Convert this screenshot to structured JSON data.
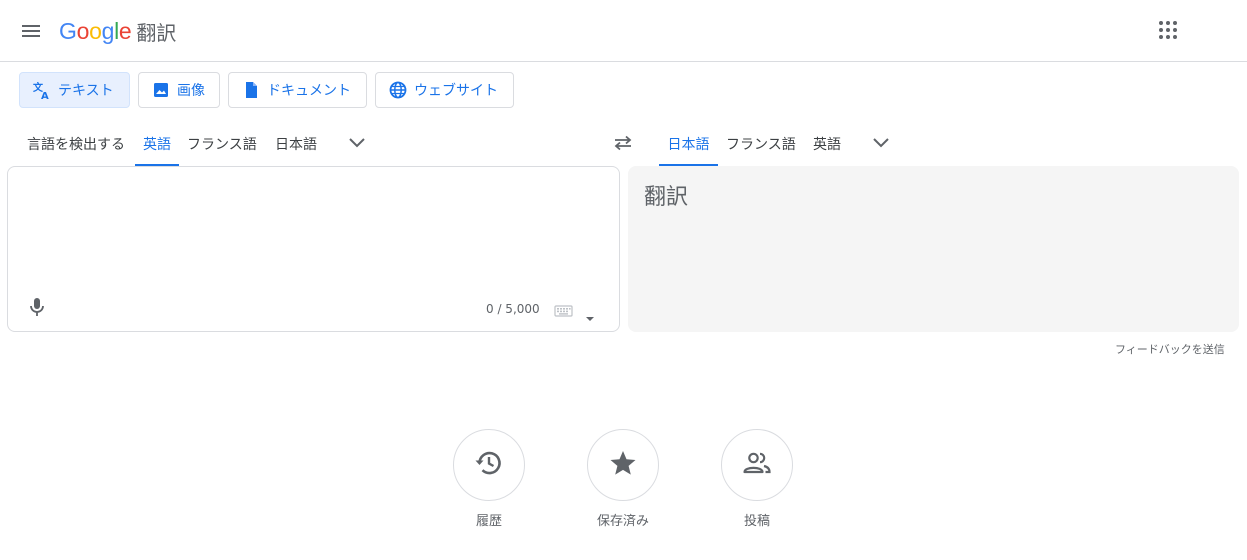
{
  "header": {
    "logo_letters": [
      "G",
      "o",
      "o",
      "g",
      "l",
      "e"
    ],
    "logo_colors": [
      "#4285F4",
      "#EA4335",
      "#FBBC05",
      "#4285F4",
      "#34A853",
      "#EA4335"
    ],
    "product": "翻訳",
    "menu_icon": "hamburger-menu-icon",
    "apps_icon": "apps-grid-icon"
  },
  "modes": [
    {
      "label": "テキスト",
      "icon": "translate-icon",
      "active": true
    },
    {
      "label": "画像",
      "icon": "image-icon",
      "active": false
    },
    {
      "label": "ドキュメント",
      "icon": "document-icon",
      "active": false
    },
    {
      "label": "ウェブサイト",
      "icon": "globe-icon",
      "active": false
    }
  ],
  "source_langs": [
    {
      "label": "言語を検出する",
      "active": false
    },
    {
      "label": "英語",
      "active": true
    },
    {
      "label": "フランス語",
      "active": false
    },
    {
      "label": "日本語",
      "active": false
    }
  ],
  "target_langs": [
    {
      "label": "日本語",
      "active": true
    },
    {
      "label": "フランス語",
      "active": false
    },
    {
      "label": "英語",
      "active": false
    }
  ],
  "source": {
    "value": "",
    "char_count": "0 / 5,000"
  },
  "target": {
    "placeholder": "翻訳"
  },
  "feedback": "フィードバックを送信",
  "bottom": [
    {
      "label": "履歴",
      "icon": "history-icon"
    },
    {
      "label": "保存済み",
      "icon": "star-icon"
    },
    {
      "label": "投稿",
      "icon": "community-icon"
    }
  ],
  "colors": {
    "accent": "#1a73e8",
    "active_mode_bg": "#e8f0fe",
    "target_bg": "#f5f5f5",
    "border": "#dadce0"
  }
}
